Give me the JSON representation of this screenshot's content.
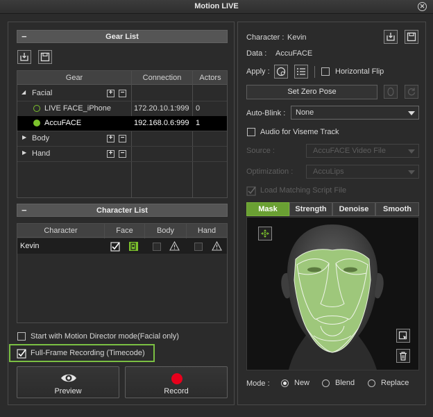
{
  "window": {
    "title": "Motion LIVE",
    "close_icon": "close-circle-icon"
  },
  "gear_list": {
    "header": "Gear List",
    "columns": [
      "Gear",
      "Connection",
      "Actors"
    ],
    "groups": {
      "facial": "Facial",
      "body": "Body",
      "hand": "Hand"
    },
    "devices": [
      {
        "name": "LIVE FACE_iPhone",
        "connection": "172.20.10.1:999",
        "actors": "0",
        "status": "idle"
      },
      {
        "name": "AccuFACE",
        "connection": "192.168.0.6:999",
        "actors": "1",
        "status": "active"
      }
    ]
  },
  "character_list": {
    "header": "Character List",
    "columns": [
      "Character",
      "Face",
      "Body",
      "Hand"
    ],
    "rows": [
      {
        "character": "Kevin"
      }
    ]
  },
  "options": {
    "motion_director": {
      "label": "Start with Motion Director mode(Facial only)",
      "checked": false
    },
    "full_frame": {
      "label": "Full-Frame Recording (Timecode)",
      "checked": true
    }
  },
  "actions": {
    "preview": "Preview",
    "record": "Record"
  },
  "details": {
    "character_label": "Character :",
    "character_value": "Kevin",
    "data_label": "Data :",
    "data_value": "AccuFACE",
    "apply_label": "Apply :",
    "horizontal_flip": "Horizontal Flip",
    "set_zero_pose": "Set Zero Pose",
    "auto_blink_label": "Auto-Blink :",
    "auto_blink_value": "None",
    "audio_viseme": "Audio for Viseme Track",
    "source_label": "Source :",
    "source_value": "AccuFACE Video File",
    "optimization_label": "Optimization :",
    "optimization_value": "AccuLips",
    "load_script": "Load Matching Script File"
  },
  "tabs": [
    "Mask",
    "Strength",
    "Denoise",
    "Smooth"
  ],
  "active_tab": "Mask",
  "mode": {
    "label": "Mode :",
    "options": [
      "New",
      "Blend",
      "Replace"
    ],
    "selected": "New"
  },
  "colors": {
    "accent_green": "#6aa033",
    "active_dot": "#7cc22c",
    "record_red": "#e8001c"
  }
}
